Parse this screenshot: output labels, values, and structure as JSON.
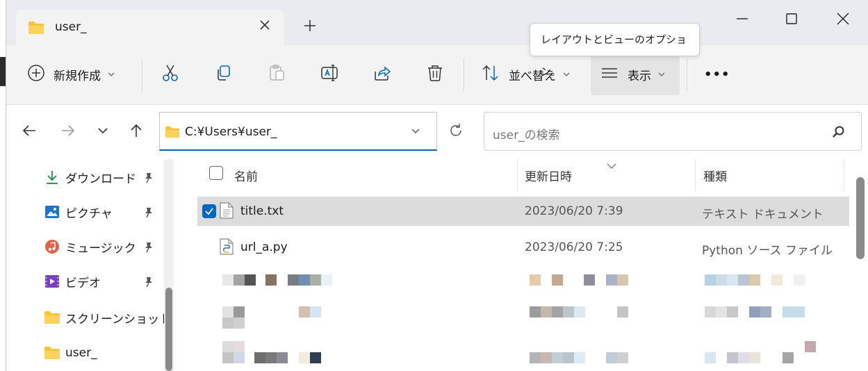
{
  "window": {
    "tab_title": "user_",
    "controls": [
      "minimize",
      "maximize",
      "close"
    ]
  },
  "toolbar": {
    "new_label": "新規作成",
    "sort_label": "並べ替え",
    "view_label": "表示",
    "more_label": "•••",
    "tooltip": "レイアウトとビューのオプション。",
    "icons": [
      "cut-icon",
      "copy-icon",
      "paste-icon",
      "rename-icon",
      "share-icon",
      "delete-icon"
    ]
  },
  "address": {
    "path": "C:¥Users¥user_",
    "search_placeholder": "user_の検索"
  },
  "sidebar": {
    "items": [
      {
        "label": "ダウンロード",
        "icon": "download-icon",
        "pinned": true
      },
      {
        "label": "ピクチャ",
        "icon": "pictures-icon",
        "pinned": true
      },
      {
        "label": "ミュージック",
        "icon": "music-icon",
        "pinned": true
      },
      {
        "label": "ビデオ",
        "icon": "video-icon",
        "pinned": true
      },
      {
        "label": "スクリーンショット",
        "icon": "folder-icon",
        "pinned": false
      },
      {
        "label": "user_",
        "icon": "folder-icon",
        "pinned": false
      }
    ]
  },
  "filelist": {
    "columns": [
      "名前",
      "更新日時",
      "種類"
    ],
    "rows": [
      {
        "name": "title.txt",
        "date": "2023/06/20 7:39",
        "type": "テキスト ドキュメント",
        "selected": true,
        "icon": "text-file-icon"
      },
      {
        "name": "url_a.py",
        "date": "2023/06/20 7:25",
        "type": "Python ソース ファイル",
        "selected": false,
        "icon": "python-file-icon"
      }
    ]
  },
  "colors": {
    "accent": "#0067c0",
    "selected_row": "#dcdcdc",
    "folder_yellow": "#f8c43a"
  }
}
